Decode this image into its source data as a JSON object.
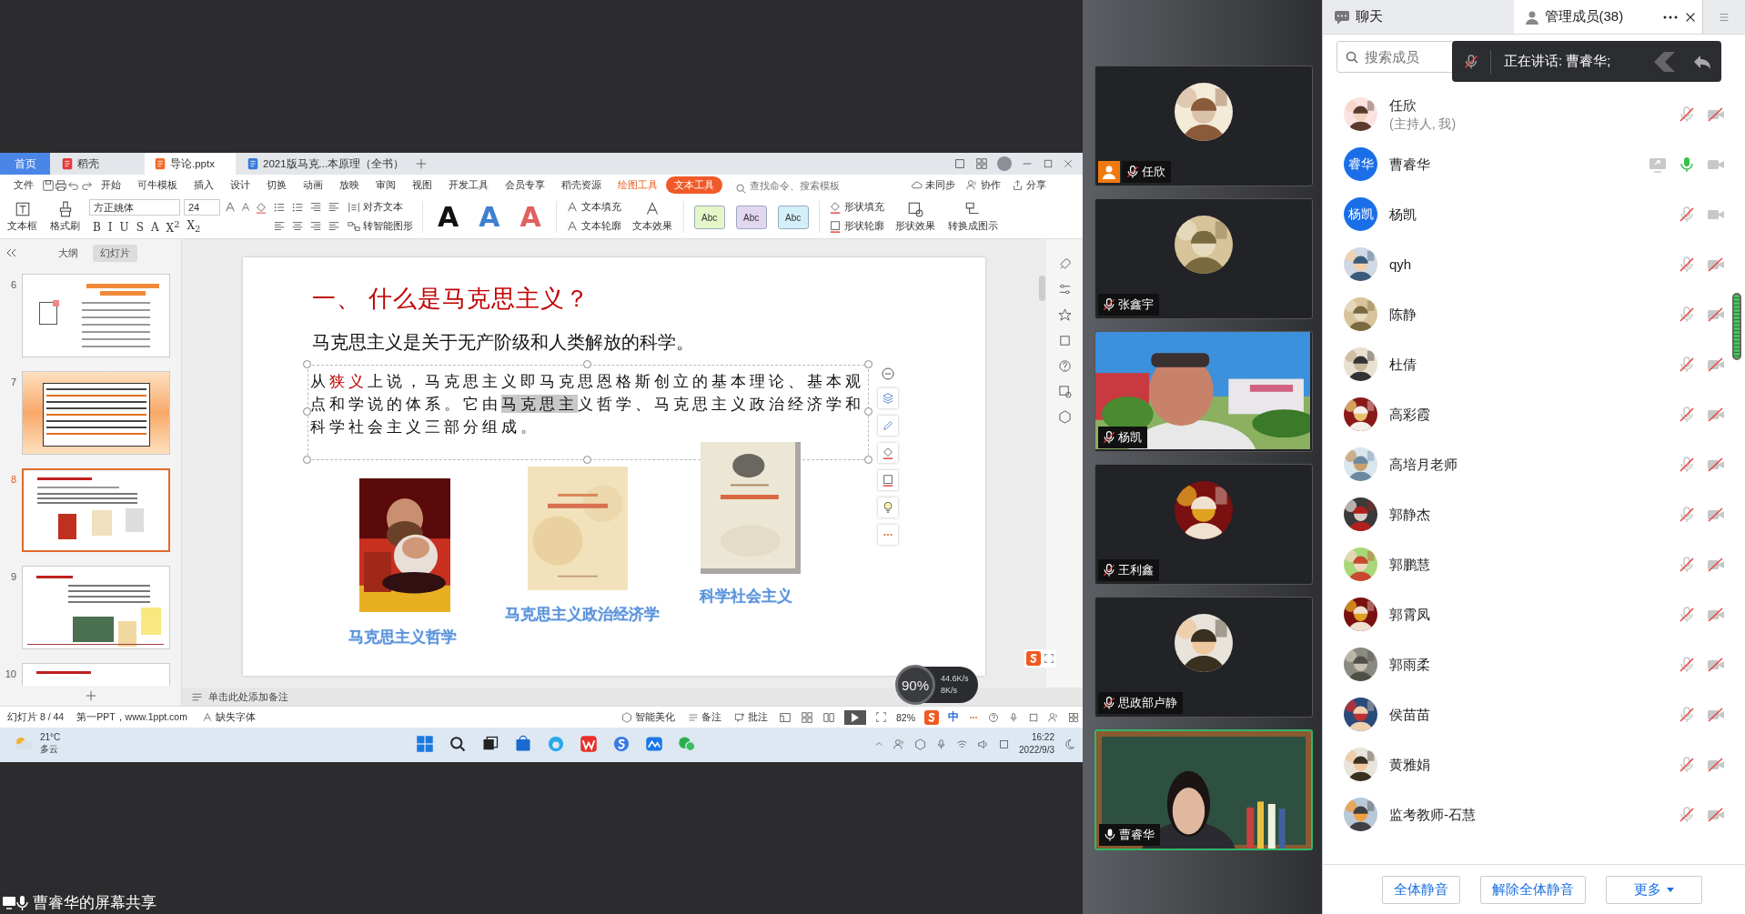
{
  "screen_share": {
    "tabs": [
      {
        "label": "首页",
        "kind": "home",
        "selected": false
      },
      {
        "label": "稻壳",
        "kind": "docer",
        "selected": false
      },
      {
        "label": "导论.pptx",
        "kind": "presentation",
        "selected": true
      },
      {
        "label": "2021版马克...本原理（全书）",
        "kind": "document",
        "selected": false
      }
    ],
    "menu": [
      {
        "label": "文件",
        "kind": "file",
        "selected": false
      },
      {
        "label": "开始",
        "kind": "tab",
        "selected": false
      },
      {
        "label": "可牛模板",
        "kind": "tab",
        "selected": false
      },
      {
        "label": "插入",
        "kind": "tab",
        "selected": false
      },
      {
        "label": "设计",
        "kind": "tab",
        "selected": false
      },
      {
        "label": "切换",
        "kind": "tab",
        "selected": false
      },
      {
        "label": "动画",
        "kind": "tab",
        "selected": false
      },
      {
        "label": "放映",
        "kind": "tab",
        "selected": false
      },
      {
        "label": "审阅",
        "kind": "tab",
        "selected": false
      },
      {
        "label": "视图",
        "kind": "tab",
        "selected": false
      },
      {
        "label": "开发工具",
        "kind": "tab",
        "selected": false
      },
      {
        "label": "会员专享",
        "kind": "tab",
        "selected": false
      },
      {
        "label": "稻壳资源",
        "kind": "tab",
        "selected": false
      },
      {
        "label": "绘图工具",
        "kind": "context",
        "selected": false
      },
      {
        "label": "文本工具",
        "kind": "context",
        "selected": true
      }
    ],
    "command_search": {
      "placeholder": "查找命令、搜索模板"
    },
    "menu_actions": [
      "未同步",
      "协作",
      "分享"
    ],
    "ribbon": {
      "insert_tools": [
        "文本框",
        "格式刷"
      ],
      "font": "方正姚体",
      "font_size": "24",
      "format_buttons": [
        "B",
        "I",
        "U",
        "S",
        "A",
        "X$^{2}$",
        "X$_{2}$"
      ],
      "align_text": "对齐文本",
      "smart_graphic": "转智能图形",
      "text_styles": [
        {
          "label": "A",
          "color": "#111111"
        },
        {
          "label": "A",
          "color": "#3d7fd0"
        },
        {
          "label": "A",
          "color": "#e06060"
        }
      ],
      "text_tools": [
        "文本填充",
        "文本轮廓",
        "文本效果"
      ],
      "shape_styles": [
        {
          "label": "Abc",
          "color": "#e6f6c9"
        },
        {
          "label": "Abc",
          "color": "#e3d6f1"
        },
        {
          "label": "Abc",
          "color": "#d3eff9"
        }
      ],
      "shape_tools": [
        "形状填充",
        "形状轮廓",
        "形状效果"
      ],
      "convert": "转换成图示"
    },
    "panel_tabs": [
      {
        "label": "大纲",
        "selected": false
      },
      {
        "label": "幻灯片",
        "selected": true
      }
    ],
    "thumbnails": [
      {
        "number": "6",
        "kind": "text",
        "selected": false
      },
      {
        "number": "7",
        "kind": "framed",
        "selected": false
      },
      {
        "number": "8",
        "kind": "pictures",
        "selected": true
      },
      {
        "number": "9",
        "kind": "books",
        "selected": false
      },
      {
        "number": "10",
        "kind": "partial",
        "selected": false
      }
    ],
    "slide": {
      "title": "一、 什么是马克思主义？",
      "subtitle": "马克思主义是关于无产阶级和人类解放的科学。",
      "paragraph": [
        {
          "text": "从",
          "kind": "plain"
        },
        {
          "text": "狭义",
          "kind": "red"
        },
        {
          "text": "上说，马克思主义即马克思恩格斯创立的基本理论、基本观点和学说的体系。它由",
          "kind": "plain"
        },
        {
          "text": "马克思主",
          "kind": "highlight"
        },
        {
          "text": "义哲学、马克思主义政治经济学和科学社会主义三部分组成。",
          "kind": "plain"
        }
      ],
      "figures": [
        {
          "kind": "picture",
          "caption": "马克思主义哲学"
        },
        {
          "kind": "picture",
          "caption": "马克思主义政治经济学"
        },
        {
          "kind": "picture",
          "caption": "科学社会主义"
        }
      ]
    },
    "notes_placeholder": "单击此处添加备注",
    "status": {
      "slide": "幻灯片 8 / 44",
      "template": "第一PPT，www.1ppt.com",
      "missing_font": "缺失字体",
      "beautify": "智能美化",
      "notes": "备注",
      "comments": "批注",
      "zoom": "82%",
      "ime": "中"
    },
    "speed": {
      "cpu": "90%",
      "upload": "44.6K/s",
      "download": "8K/s"
    },
    "taskbar": {
      "temperature": "21°C",
      "weather": "多云",
      "time": "16:22",
      "date": "2022/9/3"
    }
  },
  "videos": [
    {
      "name": "任欣",
      "kind": "avatar",
      "mic_on": false,
      "host": true,
      "speaking": false
    },
    {
      "name": "张鑫宇",
      "kind": "avatar",
      "mic_on": false,
      "host": false,
      "speaking": false
    },
    {
      "name": "杨凯",
      "kind": "video",
      "mic_on": false,
      "host": false,
      "speaking": false
    },
    {
      "name": "王利鑫",
      "kind": "avatar",
      "mic_on": false,
      "host": false,
      "speaking": false
    },
    {
      "name": "思政部卢静",
      "kind": "avatar",
      "mic_on": false,
      "host": false,
      "speaking": false
    },
    {
      "name": "曹睿华",
      "kind": "video",
      "mic_on": true,
      "host": false,
      "speaking": true
    }
  ],
  "panel": {
    "tabs": [
      {
        "label": "聊天",
        "selected": false
      },
      {
        "label": "管理成员(38)",
        "selected": true
      }
    ],
    "search": {
      "placeholder": "搜索成员"
    },
    "speaking": "正在讲话: 曹睿华;",
    "members": [
      {
        "name": "任欣",
        "role": "(主持人, 我)",
        "kind": "picture",
        "mic_on": false,
        "camera_on": false,
        "sharing": false
      },
      {
        "name": "曹睿华",
        "kind": "initials",
        "initials": "睿华",
        "mic_on": true,
        "camera_on": true,
        "sharing": true
      },
      {
        "name": "杨凯",
        "kind": "initials",
        "initials": "杨凯",
        "mic_on": false,
        "camera_on": true,
        "sharing": false
      },
      {
        "name": "qyh",
        "kind": "picture",
        "mic_on": false,
        "camera_on": false,
        "sharing": false
      },
      {
        "name": "陈静",
        "kind": "picture",
        "mic_on": false,
        "camera_on": false,
        "sharing": false
      },
      {
        "name": "杜倩",
        "kind": "picture",
        "mic_on": false,
        "camera_on": false,
        "sharing": false
      },
      {
        "name": "高彩霞",
        "kind": "picture",
        "mic_on": false,
        "camera_on": false,
        "sharing": false
      },
      {
        "name": "高培月老师",
        "kind": "picture",
        "mic_on": false,
        "camera_on": false,
        "sharing": false
      },
      {
        "name": "郭静杰",
        "kind": "picture",
        "mic_on": false,
        "camera_on": false,
        "sharing": false
      },
      {
        "name": "郭鹏慧",
        "kind": "picture",
        "mic_on": false,
        "camera_on": false,
        "sharing": false
      },
      {
        "name": "郭霄凤",
        "kind": "picture",
        "mic_on": false,
        "camera_on": false,
        "sharing": false
      },
      {
        "name": "郭雨柔",
        "kind": "picture",
        "mic_on": false,
        "camera_on": false,
        "sharing": false
      },
      {
        "name": "侯苗苗",
        "kind": "picture",
        "mic_on": false,
        "camera_on": false,
        "sharing": false
      },
      {
        "name": "黄雅娟",
        "kind": "picture",
        "mic_on": false,
        "camera_on": false,
        "sharing": false
      },
      {
        "name": "监考教师-石慧",
        "kind": "picture",
        "mic_on": false,
        "camera_on": false,
        "sharing": false
      }
    ],
    "buttons": [
      "全体静音",
      "解除全体静音",
      "更多"
    ]
  },
  "share_label": "曹睿华的屏幕共享"
}
